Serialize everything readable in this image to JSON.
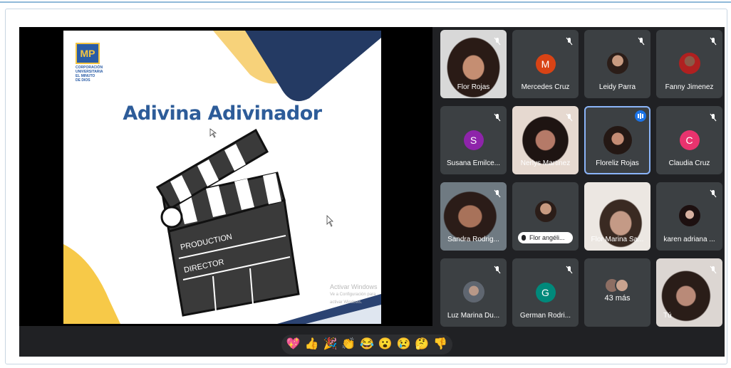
{
  "slide": {
    "title": "Adivina Adivinador",
    "logo_mark": "MP",
    "logo_lines": [
      "CORPORACIÓN",
      "UNIVERSITARIA",
      "EL MINUTO",
      "DE DIOS"
    ],
    "clapper_labels": [
      "PRODUCTION",
      "DIRECTOR"
    ],
    "watermark_title": "Activar Windows",
    "watermark_sub": "Ve a Configuración para activar Windows."
  },
  "colors": {
    "meet_bg": "#202124",
    "tile_bg": "#3c4043",
    "slide_blue": "#2d5c99",
    "slide_yellow": "#f7c948",
    "speaking_outline": "#8ab4f8"
  },
  "participants": [
    {
      "name": "Flor Rojas",
      "kind": "video",
      "muted": true
    },
    {
      "name": "Mercedes Cruz",
      "kind": "initial",
      "initial": "M",
      "color": "#d84315",
      "muted": true
    },
    {
      "name": "Leidy Parra",
      "kind": "photo",
      "muted": true
    },
    {
      "name": "Fanny Jimenez",
      "kind": "photo",
      "muted": true
    },
    {
      "name": "Susana Emilce...",
      "kind": "initial",
      "initial": "S",
      "color": "#8e24aa",
      "muted": true
    },
    {
      "name": "Nerlys Martinez",
      "kind": "video",
      "muted": true
    },
    {
      "name": "Floreliz Rojas",
      "kind": "photo",
      "muted": false,
      "speaking": true
    },
    {
      "name": "Claudia Cruz",
      "kind": "initial",
      "initial": "C",
      "color": "#e8336e",
      "muted": true
    },
    {
      "name": "Sandra Rodrig...",
      "kind": "video",
      "muted": true
    },
    {
      "name": "Flor angéli...",
      "kind": "chip",
      "muted": false
    },
    {
      "name": "Flor Marina Sa...",
      "kind": "video",
      "muted": false
    },
    {
      "name": "karen adriana ...",
      "kind": "photo",
      "muted": true
    },
    {
      "name": "Luz Marina Du...",
      "kind": "photo",
      "muted": true
    },
    {
      "name": "German Rodri...",
      "kind": "initial",
      "initial": "G",
      "color": "#00897b",
      "muted": true
    },
    {
      "name": "43 más",
      "kind": "more",
      "muted": false
    },
    {
      "name": "Tú",
      "kind": "video",
      "muted": true
    }
  ],
  "reactions": [
    {
      "icon": "sparkling-heart-icon",
      "glyph": "💖"
    },
    {
      "icon": "thumbs-up-icon",
      "glyph": "👍"
    },
    {
      "icon": "party-popper-icon",
      "glyph": "🎉"
    },
    {
      "icon": "clapping-hands-icon",
      "glyph": "👏"
    },
    {
      "icon": "tears-of-joy-icon",
      "glyph": "😂"
    },
    {
      "icon": "surprised-face-icon",
      "glyph": "😮"
    },
    {
      "icon": "sad-face-icon",
      "glyph": "😢"
    },
    {
      "icon": "thinking-face-icon",
      "glyph": "🤔"
    },
    {
      "icon": "thumbs-down-icon",
      "glyph": "👎"
    }
  ]
}
